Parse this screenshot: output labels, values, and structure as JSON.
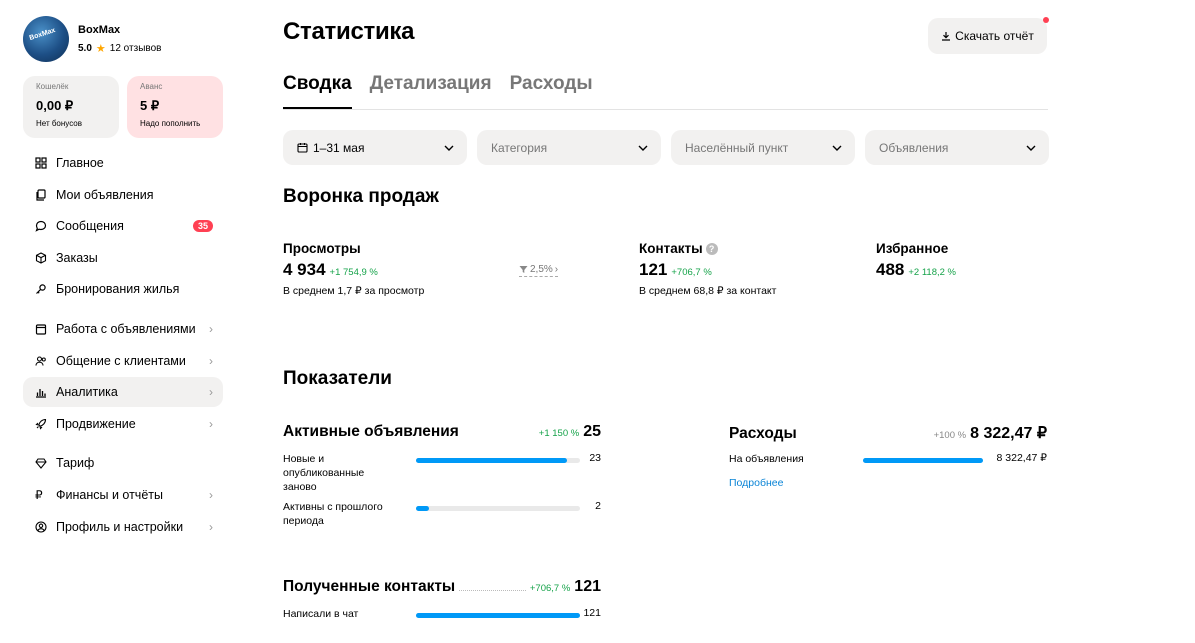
{
  "profile": {
    "name": "BoxMax",
    "rating": "5.0",
    "reviews": "12 отзывов",
    "avatar_text": "BoxMax"
  },
  "wallet": {
    "caption": "Кошелёк",
    "value": "0,00 ₽",
    "sub": "Нет бонусов"
  },
  "advance": {
    "caption": "Аванс",
    "value": "5 ₽",
    "sub": "Надо пополнить"
  },
  "nav": {
    "main": "Главное",
    "my_ads": "Мои объявления",
    "messages": "Сообщения",
    "messages_badge": "35",
    "orders": "Заказы",
    "booking": "Бронирования жилья",
    "ads_work": "Работа с объявлениями",
    "clients": "Общение с клиентами",
    "analytics": "Аналитика",
    "promotion": "Продвижение",
    "tariff": "Тариф",
    "finance": "Финансы и отчёты",
    "settings": "Профиль и настройки"
  },
  "header": {
    "title": "Статистика",
    "download": "Скачать отчёт"
  },
  "tabs": [
    "Сводка",
    "Детализация",
    "Расходы"
  ],
  "filters": {
    "date": "1–31 мая",
    "category": "Категория",
    "city": "Населённый пункт",
    "ads": "Объявления"
  },
  "funnel": {
    "title": "Воронка продаж",
    "views": {
      "label": "Просмотры",
      "value": "4 934",
      "delta": "+1 754,9 %",
      "avg": "В среднем 1,7 ₽ за просмотр"
    },
    "conversion": "2,5%",
    "contacts": {
      "label": "Контакты",
      "value": "121",
      "delta": "+706,7 %",
      "avg": "В среднем 68,8 ₽ за контакт"
    },
    "favorites": {
      "label": "Избранное",
      "value": "488",
      "delta": "+2 118,2 %"
    }
  },
  "indicators": {
    "title": "Показатели",
    "active_ads": {
      "title": "Активные объявления",
      "delta": "+1 150 %",
      "total": "25",
      "rows": [
        {
          "label": "Новые и опубликованные заново",
          "value": "23",
          "fraction": 0.92
        },
        {
          "label": "Активны с прошлого периода",
          "value": "2",
          "fraction": 0.08
        }
      ]
    },
    "expenses": {
      "title": "Расходы",
      "delta": "+100 %",
      "total": "8 322,47 ₽",
      "rows": [
        {
          "label": "На объявления",
          "value": "8 322,47 ₽",
          "fraction": 1.0
        }
      ],
      "link": "Подробнее"
    },
    "contacts": {
      "title": "Полученные контакты",
      "delta": "+706,7 %",
      "total": "121",
      "rows": [
        {
          "label": "Написали в чат",
          "value": "121",
          "fraction": 1.0
        }
      ]
    }
  },
  "colors": {
    "accent": "#0099f7",
    "positive": "#16a34a",
    "badge": "#ff4053",
    "surface": "#f2f1f0"
  }
}
